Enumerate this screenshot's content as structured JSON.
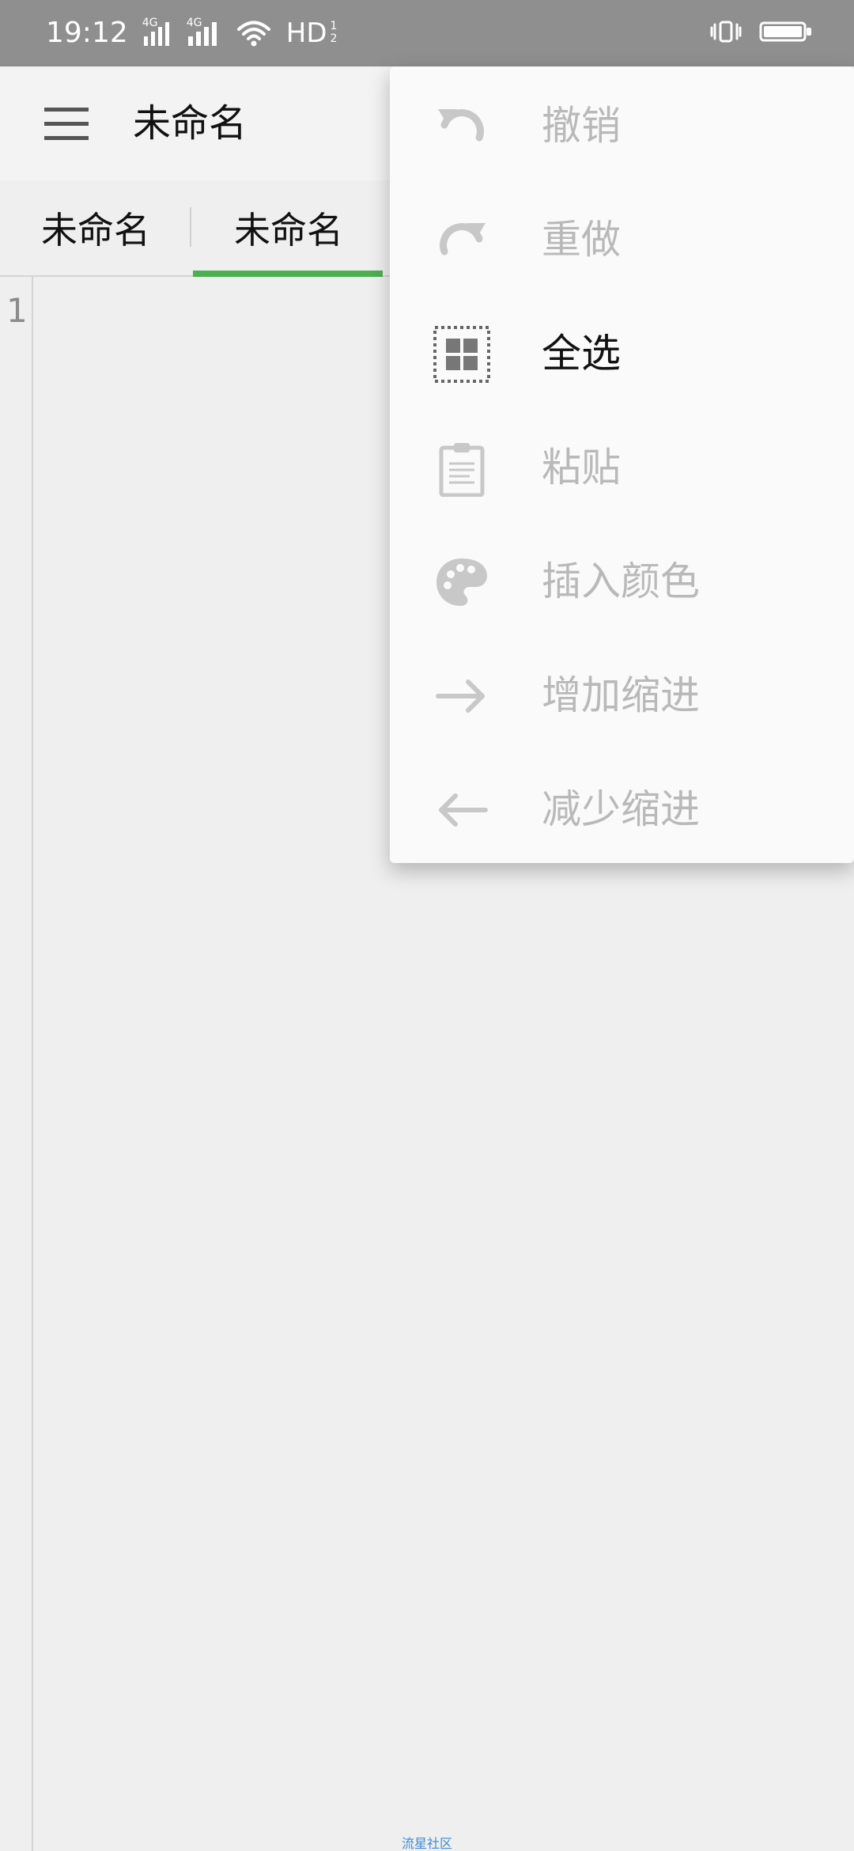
{
  "status_bar": {
    "time": "19:12",
    "network_1": "4G",
    "network_2": "4G",
    "hd": "HD",
    "hd_sub_1": "1",
    "hd_sub_2": "2",
    "icons": [
      "signal-icon",
      "signal-icon",
      "wifi-icon",
      "vibrate-icon",
      "battery-icon"
    ]
  },
  "toolbar": {
    "title": "未命名",
    "menu_icon": "menu-icon"
  },
  "tabs": [
    {
      "label": "未命名",
      "active": false
    },
    {
      "label": "未命名",
      "active": true
    }
  ],
  "editor": {
    "line_numbers": [
      "1"
    ]
  },
  "menu": {
    "items": [
      {
        "label": "撤销",
        "icon": "undo-icon",
        "enabled": false
      },
      {
        "label": "重做",
        "icon": "redo-icon",
        "enabled": false
      },
      {
        "label": "全选",
        "icon": "select-all-icon",
        "enabled": true
      },
      {
        "label": "粘贴",
        "icon": "clipboard-icon",
        "enabled": false
      },
      {
        "label": "插入颜色",
        "icon": "palette-icon",
        "enabled": false
      },
      {
        "label": "增加缩进",
        "icon": "arrow-right-icon",
        "enabled": false
      },
      {
        "label": "减少缩进",
        "icon": "arrow-left-icon",
        "enabled": false
      }
    ]
  },
  "watermark": "流星社区",
  "colors": {
    "accent": "#4caf50",
    "disabled": "#b9b9b9",
    "enabled": "#111111",
    "status_bar": "#8f8f8f"
  }
}
